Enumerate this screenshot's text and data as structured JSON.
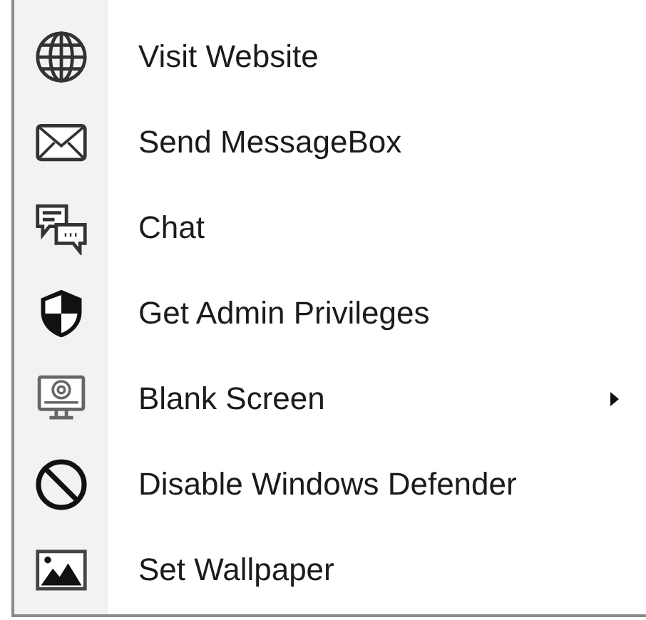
{
  "menu": {
    "items": [
      {
        "label": "Visit Website",
        "submenu": false
      },
      {
        "label": "Send MessageBox",
        "submenu": false
      },
      {
        "label": "Chat",
        "submenu": false
      },
      {
        "label": "Get Admin Privileges",
        "submenu": false
      },
      {
        "label": "Blank Screen",
        "submenu": true
      },
      {
        "label": "Disable Windows Defender",
        "submenu": false
      },
      {
        "label": "Set Wallpaper",
        "submenu": false
      }
    ]
  }
}
